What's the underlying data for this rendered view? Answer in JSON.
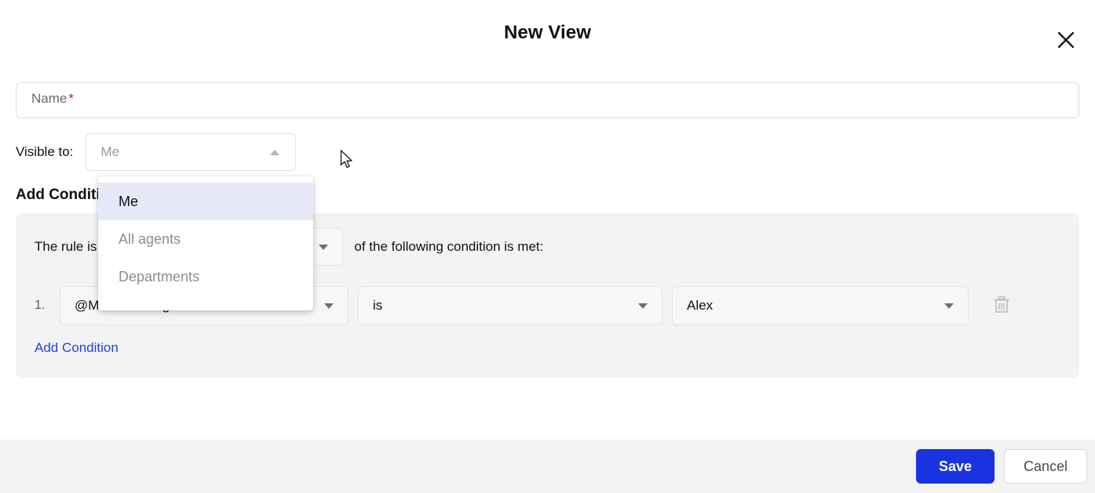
{
  "dialog": {
    "title": "New View",
    "close_icon": "close-icon"
  },
  "name_field": {
    "label": "Name",
    "required_marker": "*",
    "value": "",
    "placeholder": "Name"
  },
  "visible_to": {
    "label": "Visible to:",
    "selected": "Me",
    "caret_icon": "chevron-up-icon",
    "open": true,
    "options": [
      {
        "label": "Me",
        "selected": true
      },
      {
        "label": "All agents",
        "selected": false
      },
      {
        "label": "Departments",
        "selected": false
      }
    ]
  },
  "conditions_section": {
    "heading": "Add Conditions",
    "rule_prefix": "The rule is",
    "rule_match_selected": "",
    "rule_suffix": "of the following condition is met:",
    "rows": [
      {
        "index": "1.",
        "field": "@Mentioned Agent",
        "operator": "is",
        "value": "Alex",
        "delete_icon": "trash-icon"
      }
    ],
    "add_condition_label": "Add Condition"
  },
  "footer": {
    "save_label": "Save",
    "cancel_label": "Cancel"
  },
  "colors": {
    "accent_blue": "#1a33e0",
    "link_blue": "#2440e8",
    "panel_gray": "#f3f3f3",
    "highlight_lavender": "#e7e9f8",
    "required_red": "#b3261e"
  }
}
